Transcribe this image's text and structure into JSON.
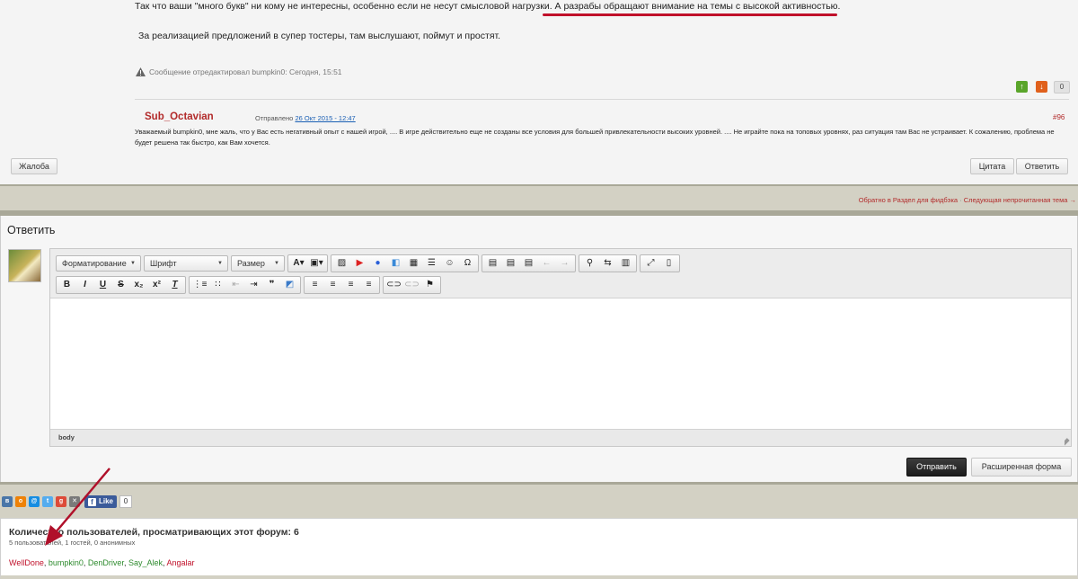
{
  "post": {
    "line1_a": "Так что ваши \"много букв\" ни кому не интересны, особенно если не несут смысловой нагрузки. ",
    "line1_b": "А разрабы обращают внимание на темы с высокой активностью.",
    "line2": "За реализацией предложений в супер тостеры, там выслушают, поймут и простят.",
    "edited_note": "Сообщение отредактировал bumpkin0: Сегодня, 15:51",
    "vote_count": "0"
  },
  "reply_post": {
    "author": "Sub_Octavian",
    "sent_label": "Отправлено ",
    "sent_date": "26 Окт 2015 - 12:47",
    "number": "#96",
    "text": "Уважаемый bumpkin0, мне жаль, что у Вас есть негативный опыт с нашей игрой, .... В игре действительно еще не созданы все условия для большей привлекательности высоких уровней. .... Не играйте пока на топовых уровнях, раз ситуация там Вас не устраивает. К сожалению, проблема не будет решена так быстро, как Вам хочется."
  },
  "actions": {
    "complain": "Жалоба",
    "quote": "Цитата",
    "reply": "Ответить"
  },
  "nav": {
    "back": "Обратно в Раздел для фидбэка",
    "separator": " · ",
    "next_unread": "Следующая непрочитанная тема →"
  },
  "reply_form": {
    "title": "Ответить",
    "formatting": "Форматирование",
    "font": "Шрифт",
    "size": "Размер",
    "status_path": "body",
    "send": "Отправить",
    "advanced": "Расширенная форма"
  },
  "social": {
    "like_label": "Like",
    "like_count": "0"
  },
  "viewers": {
    "title": "Количество пользователей, просматривающих этот форум: 6",
    "subtitle": "5 пользователей, 1 гостей, 0 анонимных",
    "users": [
      "WellDone",
      "bumpkin0",
      "DenDriver",
      "Say_Alek",
      "Angalar"
    ],
    "sep": ", "
  },
  "colors": {
    "accent_red": "#c0102a",
    "author_red": "#b22a2a",
    "band": "#d3d1c4",
    "user_green": "#2e8b2e"
  }
}
